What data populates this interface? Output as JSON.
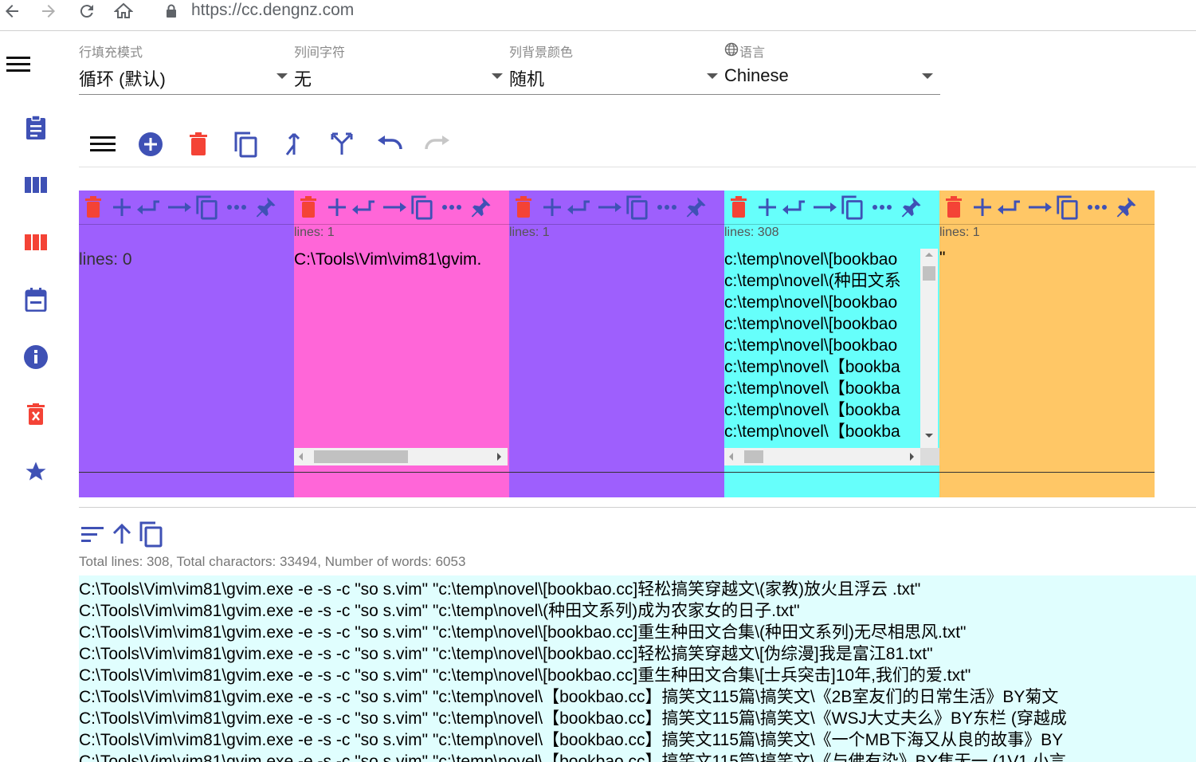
{
  "browser": {
    "url": "https://cc.dengnz.com"
  },
  "selects": [
    {
      "label": "行填充模式",
      "value": "循环 (默认)"
    },
    {
      "label": "列间字符",
      "value": "无"
    },
    {
      "label": "列背景颜色",
      "value": "随机"
    },
    {
      "label": "语言",
      "value": "Chinese"
    }
  ],
  "columns": [
    {
      "color": "#9e5ffd",
      "lines_label": "lines: 0",
      "lines_small": "",
      "content": [],
      "end_quote": ""
    },
    {
      "color": "#ff66d8",
      "lines_label": "",
      "lines_small": "lines: 1",
      "content": [
        "C:\\Tools\\Vim\\vim81\\gvim."
      ],
      "end_quote": "\""
    },
    {
      "color": "#9e5ffd",
      "lines_label": "",
      "lines_small": "lines: 1",
      "content": [],
      "end_quote": ""
    },
    {
      "color": "#66fffb",
      "lines_label": "",
      "lines_small": "lines: 308",
      "content": [
        "c:\\temp\\novel\\[bookbao",
        "c:\\temp\\novel\\(种田文系",
        "c:\\temp\\novel\\[bookbao",
        "c:\\temp\\novel\\[bookbao",
        "c:\\temp\\novel\\[bookbao",
        "c:\\temp\\novel\\【bookba",
        "c:\\temp\\novel\\【bookba",
        "c:\\temp\\novel\\【bookba",
        "c:\\temp\\novel\\【bookba"
      ],
      "end_quote": ""
    },
    {
      "color": "#ffc766",
      "lines_label": "",
      "lines_small": "lines: 1",
      "content": [],
      "end_quote": "\""
    }
  ],
  "stats": "Total lines: 308, Total charactors: 33494, Number of words: 6053",
  "output_lines": [
    "C:\\Tools\\Vim\\vim81\\gvim.exe -e -s -c \"so s.vim\" \"c:\\temp\\novel\\[bookbao.cc]轻松搞笑穿越文\\(家教)放火且浮云 .txt\"",
    "C:\\Tools\\Vim\\vim81\\gvim.exe -e -s -c \"so s.vim\" \"c:\\temp\\novel\\(种田文系列)成为农家女的日子.txt\"",
    "C:\\Tools\\Vim\\vim81\\gvim.exe -e -s -c \"so s.vim\" \"c:\\temp\\novel\\[bookbao.cc]重生种田文合集\\(种田文系列)无尽相思风.txt\"",
    "C:\\Tools\\Vim\\vim81\\gvim.exe -e -s -c \"so s.vim\" \"c:\\temp\\novel\\[bookbao.cc]轻松搞笑穿越文\\[伪综漫]我是富江81.txt\"",
    "C:\\Tools\\Vim\\vim81\\gvim.exe -e -s -c \"so s.vim\" \"c:\\temp\\novel\\[bookbao.cc]重生种田文合集\\[士兵突击]10年,我们的爱.txt\"",
    "C:\\Tools\\Vim\\vim81\\gvim.exe -e -s -c \"so s.vim\" \"c:\\temp\\novel\\【bookbao.cc】搞笑文115篇\\搞笑文\\《2B室友们的日常生活》BY菊文",
    "C:\\Tools\\Vim\\vim81\\gvim.exe -e -s -c \"so s.vim\" \"c:\\temp\\novel\\【bookbao.cc】搞笑文115篇\\搞笑文\\《WSJ大丈夫么》BY东栏 (穿越成",
    "C:\\Tools\\Vim\\vim81\\gvim.exe -e -s -c \"so s.vim\" \"c:\\temp\\novel\\【bookbao.cc】搞笑文115篇\\搞笑文\\《一个MB下海又从良的故事》BY",
    "C:\\Tools\\Vim\\vim81\\gvim.exe -e -s -c \"so s.vim\" \"c:\\temp\\novel\\【bookbao.cc】搞笑文115篇\\搞笑文\\《与佛有染》BY焦无一 (1V1 小言"
  ],
  "colors": {
    "primary": "#3f51b5",
    "delete": "#f44336",
    "purple": "#9e5ffd",
    "pink": "#ff66d8",
    "cyan": "#66fffb",
    "orange": "#ffc766",
    "output_bg": "#e0fefe"
  }
}
